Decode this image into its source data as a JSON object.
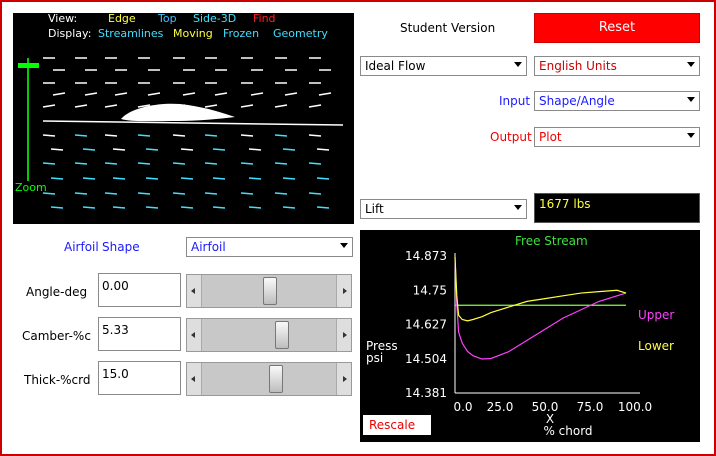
{
  "flow_view": {
    "view_label": "View:",
    "view_options": [
      "Edge",
      "Top",
      "Side-3D",
      "Find"
    ],
    "display_label": "Display:",
    "display_options": [
      "Streamlines",
      "Moving",
      "Frozen",
      "Geometry"
    ],
    "zoom_label": "Zoom",
    "colors": {
      "edge": "#ffff40",
      "top": "#40c0ff",
      "side3d": "#40e0ff",
      "find": "#ff2020",
      "streamlines": "#40e0ff",
      "moving": "#ffff40",
      "frozen": "#40e0ff",
      "geometry": "#40e0ff",
      "zoom": "#00ff00"
    }
  },
  "header": {
    "version_text": "Student Version",
    "reset_label": "Reset"
  },
  "controls": {
    "flow_type": "Ideal Flow",
    "units": "English Units",
    "input_label": "Input",
    "input_value": "Shape/Angle",
    "output_label": "Output",
    "output_value": "Plot",
    "result_select": "Lift",
    "result_value": "1677 lbs"
  },
  "airfoil_panel": {
    "airfoil_label": "Airfoil",
    "shape_label": "Shape",
    "shape_select": "Airfoil",
    "angle_label": "Angle-deg",
    "angle_value": "0.00",
    "angle_slider": 0.5,
    "camber_label": "Camber-%c",
    "camber_value": "5.33",
    "camber_slider": 0.6,
    "thick_label": "Thick-%crd",
    "thick_value": "15.0",
    "thick_slider": 0.55
  },
  "plot": {
    "rescale_label": "Rescale",
    "free_stream_label": "Free Stream",
    "upper_label": "Upper",
    "lower_label": "Lower",
    "ylabel_line1": "Press",
    "ylabel_line2": "psi",
    "xlabel_line1": "X",
    "xlabel_line2": "% chord",
    "yticks": [
      "14.873",
      "14.75",
      "14.627",
      "14.504",
      "14.381"
    ],
    "xticks": [
      "0.0",
      "25.0",
      "50.0",
      "75.0",
      "100.0"
    ]
  },
  "chart_data": {
    "type": "line",
    "title": "",
    "xlabel": "X % chord",
    "ylabel": "Press psi",
    "xlim": [
      0,
      100
    ],
    "ylim": [
      14.381,
      14.873
    ],
    "grid": false,
    "legend": "right",
    "series": [
      {
        "name": "Free Stream",
        "color": "#80ff40",
        "x": [
          0,
          95
        ],
        "y": [
          14.696,
          14.696
        ]
      },
      {
        "name": "Upper",
        "color": "#ff40ff",
        "x": [
          0,
          1,
          2,
          4,
          7,
          10,
          15,
          20,
          30,
          40,
          50,
          60,
          70,
          80,
          90,
          95
        ],
        "y": [
          14.87,
          14.7,
          14.6,
          14.56,
          14.53,
          14.515,
          14.503,
          14.505,
          14.53,
          14.57,
          14.61,
          14.65,
          14.68,
          14.71,
          14.73,
          14.74
        ]
      },
      {
        "name": "Lower",
        "color": "#ffff40",
        "x": [
          0,
          1,
          2,
          4,
          7,
          10,
          15,
          20,
          30,
          40,
          50,
          60,
          70,
          80,
          90,
          95
        ],
        "y": [
          14.87,
          14.73,
          14.66,
          14.645,
          14.64,
          14.645,
          14.655,
          14.67,
          14.69,
          14.71,
          14.72,
          14.73,
          14.74,
          14.745,
          14.75,
          14.74
        ]
      }
    ]
  }
}
